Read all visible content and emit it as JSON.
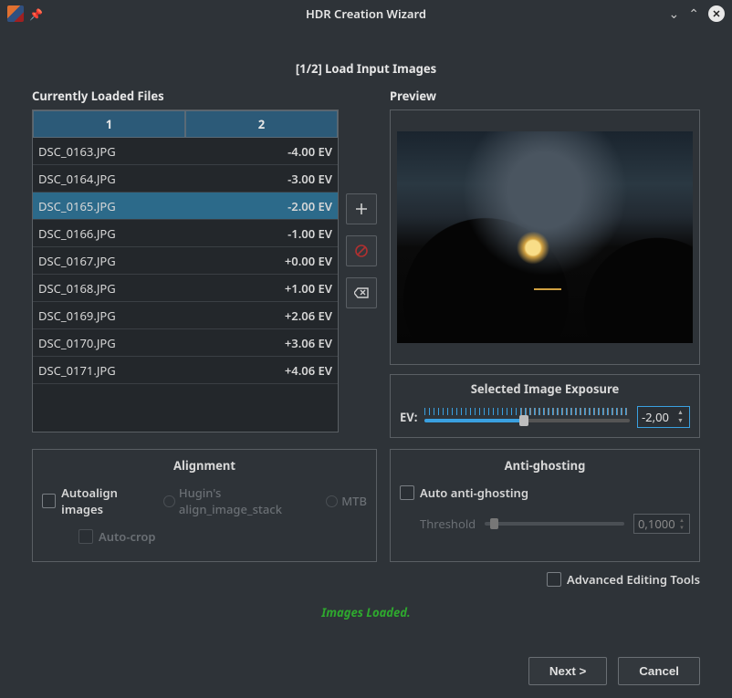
{
  "window": {
    "title": "HDR Creation Wizard"
  },
  "step_label": "[1/2] Load Input Images",
  "loaded_files_title": "Currently Loaded Files",
  "preview_title": "Preview",
  "table": {
    "col1": "1",
    "col2": "2",
    "rows": [
      {
        "name": "DSC_0163.JPG",
        "ev": "-4.00 EV",
        "selected": false
      },
      {
        "name": "DSC_0164.JPG",
        "ev": "-3.00 EV",
        "selected": false
      },
      {
        "name": "DSC_0165.JPG",
        "ev": "-2.00 EV",
        "selected": true
      },
      {
        "name": "DSC_0166.JPG",
        "ev": "-1.00 EV",
        "selected": false
      },
      {
        "name": "DSC_0167.JPG",
        "ev": "+0.00 EV",
        "selected": false
      },
      {
        "name": "DSC_0168.JPG",
        "ev": "+1.00 EV",
        "selected": false
      },
      {
        "name": "DSC_0169.JPG",
        "ev": "+2.06 EV",
        "selected": false
      },
      {
        "name": "DSC_0170.JPG",
        "ev": "+3.06 EV",
        "selected": false
      },
      {
        "name": "DSC_0171.JPG",
        "ev": "+4.06 EV",
        "selected": false
      }
    ]
  },
  "exposure": {
    "title": "Selected Image Exposure",
    "label": "EV:",
    "value": "-2,00"
  },
  "alignment": {
    "title": "Alignment",
    "autoalign": "Autoalign images",
    "engine_hugin": "Hugin's align_image_stack",
    "engine_mtb": "MTB",
    "autocrop": "Auto-crop"
  },
  "antighost": {
    "title": "Anti-ghosting",
    "auto": "Auto anti-ghosting",
    "threshold_label": "Threshold",
    "threshold_value": "0,1000"
  },
  "advanced_label": "Advanced Editing Tools",
  "status": "Images Loaded.",
  "buttons": {
    "next": "Next >",
    "cancel": "Cancel"
  }
}
